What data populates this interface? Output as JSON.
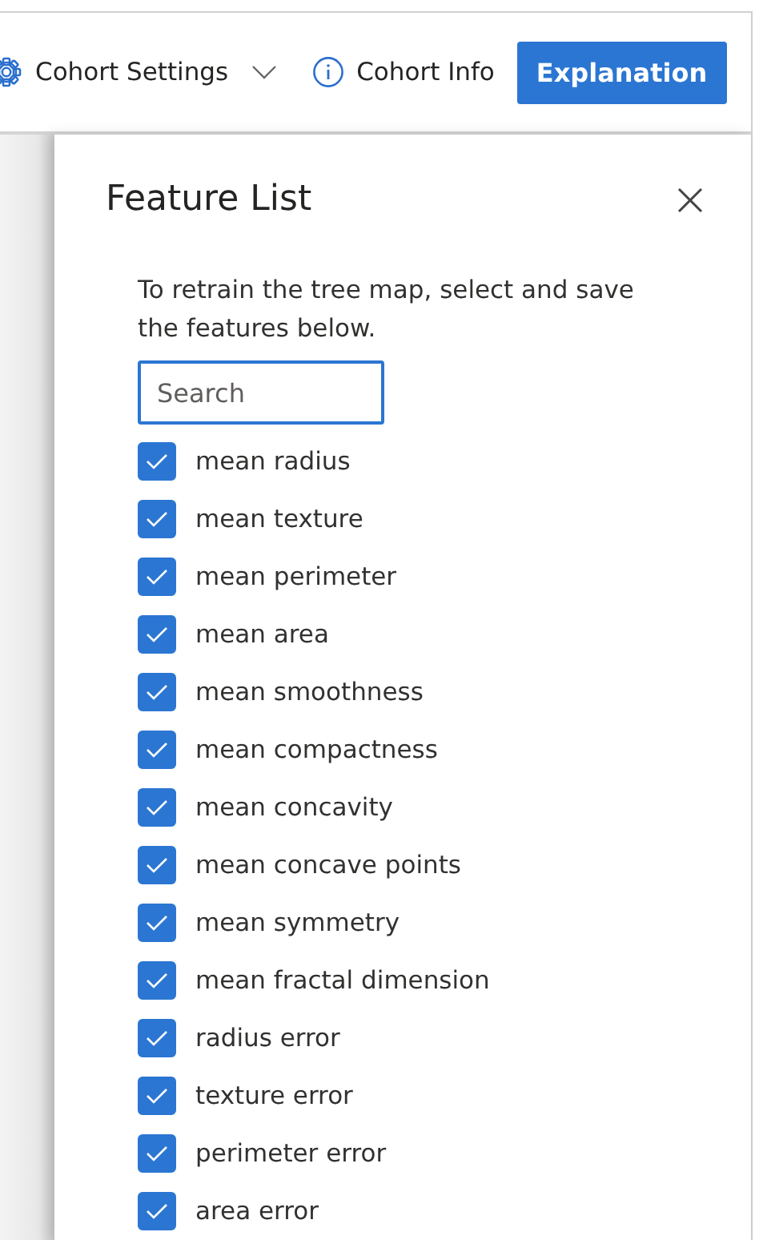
{
  "toolbar": {
    "cohort_settings": "Cohort Settings",
    "cohort_info": "Cohort Info",
    "explanation_button": "Explanation"
  },
  "panel": {
    "title": "Feature List",
    "description": "To retrain the tree map, select and save the features below.",
    "search": {
      "placeholder": "Search"
    },
    "features": [
      {
        "label": "mean radius",
        "checked": true
      },
      {
        "label": "mean texture",
        "checked": true
      },
      {
        "label": "mean perimeter",
        "checked": true
      },
      {
        "label": "mean area",
        "checked": true
      },
      {
        "label": "mean smoothness",
        "checked": true
      },
      {
        "label": "mean compactness",
        "checked": true
      },
      {
        "label": "mean concavity",
        "checked": true
      },
      {
        "label": "mean concave points",
        "checked": true
      },
      {
        "label": "mean symmetry",
        "checked": true
      },
      {
        "label": "mean fractal dimension",
        "checked": true
      },
      {
        "label": "radius error",
        "checked": true
      },
      {
        "label": "texture error",
        "checked": true
      },
      {
        "label": "perimeter error",
        "checked": true
      },
      {
        "label": "area error",
        "checked": true
      }
    ]
  }
}
